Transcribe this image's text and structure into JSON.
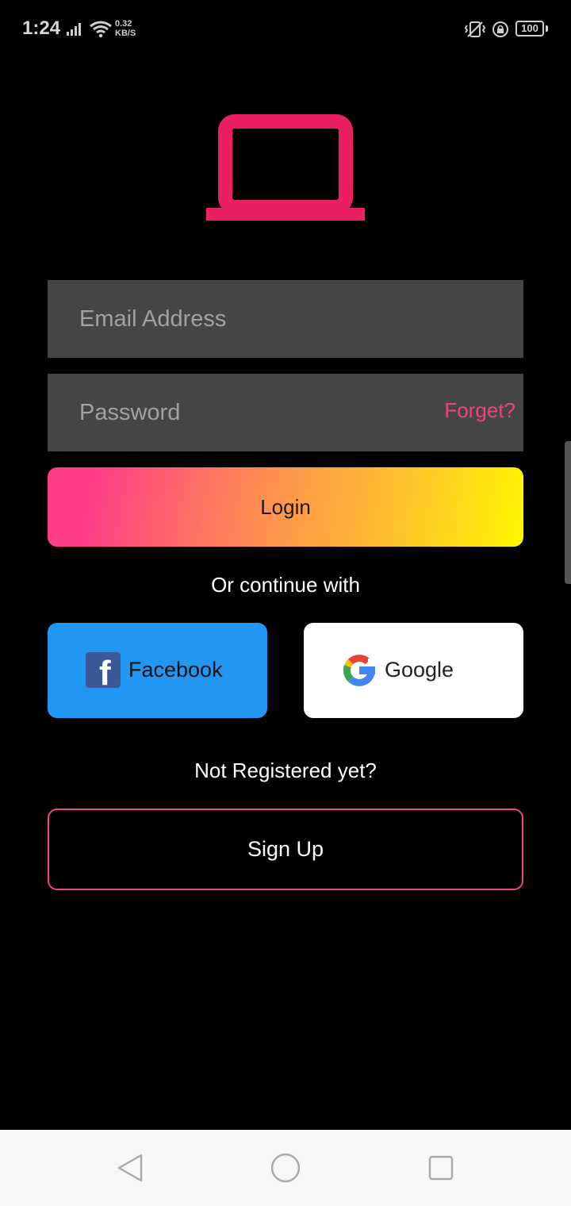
{
  "status_bar": {
    "time": "1:24",
    "net_speed_value": "0.32",
    "net_speed_unit": "KB/S",
    "battery": "100",
    "icons": [
      "signal-icon",
      "wifi-icon",
      "vibrate-icon",
      "rotation-lock-icon",
      "battery-icon"
    ]
  },
  "logo": {
    "icon": "laptop-icon",
    "color": "#e91e63"
  },
  "form": {
    "email_placeholder": "Email Address",
    "password_placeholder": "Password",
    "forget_label": "Forget?",
    "login_label": "Login"
  },
  "social": {
    "prompt": "Or continue with",
    "facebook_label": "Facebook",
    "google_label": "Google"
  },
  "register": {
    "prompt": "Not Registered yet?",
    "signup_label": "Sign Up"
  },
  "colors": {
    "accent": "#ef4878",
    "facebook_button": "#2196f3",
    "input_background": "#454547"
  },
  "nav_bar": {
    "icons": [
      "back-icon",
      "home-icon",
      "recents-icon"
    ]
  }
}
